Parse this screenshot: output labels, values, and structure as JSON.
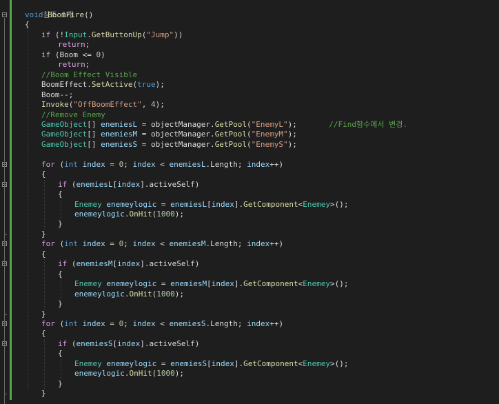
{
  "editor": {
    "reference_hint": "참조 1개",
    "lines": [
      {
        "indent": 0,
        "tokens": [
          {
            "c": "kw",
            "t": "void"
          },
          {
            "c": "plain",
            "t": " "
          },
          {
            "c": "fn",
            "t": "BoomFire"
          },
          {
            "c": "plain",
            "t": "()"
          }
        ]
      },
      {
        "indent": 0,
        "tokens": [
          {
            "c": "plain",
            "t": "{"
          }
        ]
      },
      {
        "indent": 1,
        "tokens": [
          {
            "c": "ctrl",
            "t": "if"
          },
          {
            "c": "plain",
            "t": " (!"
          },
          {
            "c": "ty",
            "t": "Input"
          },
          {
            "c": "plain",
            "t": "."
          },
          {
            "c": "fn",
            "t": "GetButtonUp"
          },
          {
            "c": "plain",
            "t": "("
          },
          {
            "c": "str",
            "t": "\"Jump\""
          },
          {
            "c": "plain",
            "t": "))"
          }
        ]
      },
      {
        "indent": 2,
        "tokens": [
          {
            "c": "ctrl",
            "t": "return"
          },
          {
            "c": "plain",
            "t": ";"
          }
        ]
      },
      {
        "indent": 1,
        "tokens": [
          {
            "c": "ctrl",
            "t": "if"
          },
          {
            "c": "plain",
            "t": " (Boom <= "
          },
          {
            "c": "num",
            "t": "0"
          },
          {
            "c": "plain",
            "t": ")"
          }
        ]
      },
      {
        "indent": 2,
        "tokens": [
          {
            "c": "ctrl",
            "t": "return"
          },
          {
            "c": "plain",
            "t": ";"
          }
        ]
      },
      {
        "indent": 1,
        "tokens": [
          {
            "c": "cm",
            "t": "//Boom Effect Visible"
          }
        ]
      },
      {
        "indent": 1,
        "tokens": [
          {
            "c": "plain",
            "t": "BoomEffect."
          },
          {
            "c": "fn",
            "t": "SetActive"
          },
          {
            "c": "plain",
            "t": "("
          },
          {
            "c": "kw",
            "t": "true"
          },
          {
            "c": "plain",
            "t": ");"
          }
        ]
      },
      {
        "indent": 1,
        "tokens": [
          {
            "c": "plain",
            "t": "Boom--;"
          }
        ]
      },
      {
        "indent": 1,
        "tokens": [
          {
            "c": "fn",
            "t": "Invoke"
          },
          {
            "c": "plain",
            "t": "("
          },
          {
            "c": "str",
            "t": "\"OffBoomEffect\""
          },
          {
            "c": "plain",
            "t": ", "
          },
          {
            "c": "num",
            "t": "4"
          },
          {
            "c": "plain",
            "t": ");"
          }
        ]
      },
      {
        "indent": 1,
        "tokens": [
          {
            "c": "cm",
            "t": "//Remove Enemy"
          }
        ]
      },
      {
        "indent": 1,
        "tokens": [
          {
            "c": "ty",
            "t": "GameObject"
          },
          {
            "c": "plain",
            "t": "[] "
          },
          {
            "c": "var",
            "t": "enemiesL"
          },
          {
            "c": "plain",
            "t": " = objectManager."
          },
          {
            "c": "fn",
            "t": "GetPool"
          },
          {
            "c": "plain",
            "t": "("
          },
          {
            "c": "str",
            "t": "\"EnemyL\""
          },
          {
            "c": "plain",
            "t": ");       "
          },
          {
            "c": "cm",
            "t": "//Find함수에서 변경."
          }
        ]
      },
      {
        "indent": 1,
        "tokens": [
          {
            "c": "ty",
            "t": "GameObject"
          },
          {
            "c": "plain",
            "t": "[] "
          },
          {
            "c": "var",
            "t": "enemiesM"
          },
          {
            "c": "plain",
            "t": " = objectManager."
          },
          {
            "c": "fn",
            "t": "GetPool"
          },
          {
            "c": "plain",
            "t": "("
          },
          {
            "c": "str",
            "t": "\"EnemyM\""
          },
          {
            "c": "plain",
            "t": ");"
          }
        ]
      },
      {
        "indent": 1,
        "tokens": [
          {
            "c": "ty",
            "t": "GameObject"
          },
          {
            "c": "plain",
            "t": "[] "
          },
          {
            "c": "var",
            "t": "enemiesS"
          },
          {
            "c": "plain",
            "t": " = objectManager."
          },
          {
            "c": "fn",
            "t": "GetPool"
          },
          {
            "c": "plain",
            "t": "("
          },
          {
            "c": "str",
            "t": "\"EnemyS\""
          },
          {
            "c": "plain",
            "t": ");"
          }
        ]
      },
      {
        "indent": 0,
        "tokens": []
      },
      {
        "indent": 1,
        "tokens": [
          {
            "c": "ctrl",
            "t": "for"
          },
          {
            "c": "plain",
            "t": " ("
          },
          {
            "c": "kw",
            "t": "int"
          },
          {
            "c": "plain",
            "t": " "
          },
          {
            "c": "var",
            "t": "index"
          },
          {
            "c": "plain",
            "t": " = "
          },
          {
            "c": "num",
            "t": "0"
          },
          {
            "c": "plain",
            "t": "; "
          },
          {
            "c": "var",
            "t": "index"
          },
          {
            "c": "plain",
            "t": " < "
          },
          {
            "c": "var",
            "t": "enemiesL"
          },
          {
            "c": "plain",
            "t": ".Length; "
          },
          {
            "c": "var",
            "t": "index"
          },
          {
            "c": "plain",
            "t": "++)"
          }
        ]
      },
      {
        "indent": 1,
        "tokens": [
          {
            "c": "plain",
            "t": "{"
          }
        ]
      },
      {
        "indent": 2,
        "tokens": [
          {
            "c": "ctrl",
            "t": "if"
          },
          {
            "c": "plain",
            "t": " ("
          },
          {
            "c": "var",
            "t": "enemiesL"
          },
          {
            "c": "plain",
            "t": "["
          },
          {
            "c": "var",
            "t": "index"
          },
          {
            "c": "plain",
            "t": "].activeSelf)"
          }
        ]
      },
      {
        "indent": 2,
        "tokens": [
          {
            "c": "plain",
            "t": "{"
          }
        ]
      },
      {
        "indent": 3,
        "tokens": [
          {
            "c": "ty",
            "t": "Enemey"
          },
          {
            "c": "plain",
            "t": " "
          },
          {
            "c": "var",
            "t": "enemeylogic"
          },
          {
            "c": "plain",
            "t": " = "
          },
          {
            "c": "var",
            "t": "enemiesL"
          },
          {
            "c": "plain",
            "t": "["
          },
          {
            "c": "var",
            "t": "index"
          },
          {
            "c": "plain",
            "t": "]."
          },
          {
            "c": "fn",
            "t": "GetComponent"
          },
          {
            "c": "plain",
            "t": "<"
          },
          {
            "c": "ty",
            "t": "Enemey"
          },
          {
            "c": "plain",
            "t": ">();"
          }
        ]
      },
      {
        "indent": 3,
        "tokens": [
          {
            "c": "var",
            "t": "enemeylogic"
          },
          {
            "c": "plain",
            "t": "."
          },
          {
            "c": "fn",
            "t": "OnHit"
          },
          {
            "c": "plain",
            "t": "("
          },
          {
            "c": "num",
            "t": "1000"
          },
          {
            "c": "plain",
            "t": ");"
          }
        ]
      },
      {
        "indent": 2,
        "tokens": [
          {
            "c": "plain",
            "t": "}"
          }
        ]
      },
      {
        "indent": 1,
        "tokens": [
          {
            "c": "plain",
            "t": "}"
          }
        ]
      },
      {
        "indent": 1,
        "tokens": [
          {
            "c": "ctrl",
            "t": "for"
          },
          {
            "c": "plain",
            "t": " ("
          },
          {
            "c": "kw",
            "t": "int"
          },
          {
            "c": "plain",
            "t": " "
          },
          {
            "c": "var",
            "t": "index"
          },
          {
            "c": "plain",
            "t": " = "
          },
          {
            "c": "num",
            "t": "0"
          },
          {
            "c": "plain",
            "t": "; "
          },
          {
            "c": "var",
            "t": "index"
          },
          {
            "c": "plain",
            "t": " < "
          },
          {
            "c": "var",
            "t": "enemiesM"
          },
          {
            "c": "plain",
            "t": ".Length; "
          },
          {
            "c": "var",
            "t": "index"
          },
          {
            "c": "plain",
            "t": "++)"
          }
        ]
      },
      {
        "indent": 1,
        "tokens": [
          {
            "c": "plain",
            "t": "{"
          }
        ]
      },
      {
        "indent": 2,
        "tokens": [
          {
            "c": "ctrl",
            "t": "if"
          },
          {
            "c": "plain",
            "t": " ("
          },
          {
            "c": "var",
            "t": "enemiesM"
          },
          {
            "c": "plain",
            "t": "["
          },
          {
            "c": "var",
            "t": "index"
          },
          {
            "c": "plain",
            "t": "].activeSelf)"
          }
        ]
      },
      {
        "indent": 2,
        "tokens": [
          {
            "c": "plain",
            "t": "{"
          }
        ]
      },
      {
        "indent": 3,
        "tokens": [
          {
            "c": "ty",
            "t": "Enemey"
          },
          {
            "c": "plain",
            "t": " "
          },
          {
            "c": "var",
            "t": "enemeylogic"
          },
          {
            "c": "plain",
            "t": " = "
          },
          {
            "c": "var",
            "t": "enemiesM"
          },
          {
            "c": "plain",
            "t": "["
          },
          {
            "c": "var",
            "t": "index"
          },
          {
            "c": "plain",
            "t": "]."
          },
          {
            "c": "fn",
            "t": "GetComponent"
          },
          {
            "c": "plain",
            "t": "<"
          },
          {
            "c": "ty",
            "t": "Enemey"
          },
          {
            "c": "plain",
            "t": ">();"
          }
        ]
      },
      {
        "indent": 3,
        "tokens": [
          {
            "c": "var",
            "t": "enemeylogic"
          },
          {
            "c": "plain",
            "t": "."
          },
          {
            "c": "fn",
            "t": "OnHit"
          },
          {
            "c": "plain",
            "t": "("
          },
          {
            "c": "num",
            "t": "1000"
          },
          {
            "c": "plain",
            "t": ");"
          }
        ]
      },
      {
        "indent": 2,
        "tokens": [
          {
            "c": "plain",
            "t": "}"
          }
        ]
      },
      {
        "indent": 1,
        "tokens": [
          {
            "c": "plain",
            "t": "}"
          }
        ]
      },
      {
        "indent": 1,
        "tokens": [
          {
            "c": "ctrl",
            "t": "for"
          },
          {
            "c": "plain",
            "t": " ("
          },
          {
            "c": "kw",
            "t": "int"
          },
          {
            "c": "plain",
            "t": " "
          },
          {
            "c": "var",
            "t": "index"
          },
          {
            "c": "plain",
            "t": " = "
          },
          {
            "c": "num",
            "t": "0"
          },
          {
            "c": "plain",
            "t": "; "
          },
          {
            "c": "var",
            "t": "index"
          },
          {
            "c": "plain",
            "t": " < "
          },
          {
            "c": "var",
            "t": "enemiesS"
          },
          {
            "c": "plain",
            "t": ".Length; "
          },
          {
            "c": "var",
            "t": "index"
          },
          {
            "c": "plain",
            "t": "++)"
          }
        ]
      },
      {
        "indent": 1,
        "tokens": [
          {
            "c": "plain",
            "t": "{"
          }
        ]
      },
      {
        "indent": 2,
        "tokens": [
          {
            "c": "ctrl",
            "t": "if"
          },
          {
            "c": "plain",
            "t": " ("
          },
          {
            "c": "var",
            "t": "enemiesS"
          },
          {
            "c": "plain",
            "t": "["
          },
          {
            "c": "var",
            "t": "index"
          },
          {
            "c": "plain",
            "t": "].activeSelf)"
          }
        ]
      },
      {
        "indent": 2,
        "tokens": [
          {
            "c": "plain",
            "t": "{"
          }
        ]
      },
      {
        "indent": 3,
        "tokens": [
          {
            "c": "ty",
            "t": "Enemey"
          },
          {
            "c": "plain",
            "t": " "
          },
          {
            "c": "var",
            "t": "enemeylogic"
          },
          {
            "c": "plain",
            "t": " = "
          },
          {
            "c": "var",
            "t": "enemiesS"
          },
          {
            "c": "plain",
            "t": "["
          },
          {
            "c": "var",
            "t": "index"
          },
          {
            "c": "plain",
            "t": "]."
          },
          {
            "c": "fn",
            "t": "GetComponent"
          },
          {
            "c": "plain",
            "t": "<"
          },
          {
            "c": "ty",
            "t": "Enemey"
          },
          {
            "c": "plain",
            "t": ">();"
          }
        ]
      },
      {
        "indent": 3,
        "tokens": [
          {
            "c": "var",
            "t": "enemeylogic"
          },
          {
            "c": "plain",
            "t": "."
          },
          {
            "c": "fn",
            "t": "OnHit"
          },
          {
            "c": "plain",
            "t": "("
          },
          {
            "c": "num",
            "t": "1000"
          },
          {
            "c": "plain",
            "t": ");"
          }
        ]
      },
      {
        "indent": 2,
        "tokens": [
          {
            "c": "plain",
            "t": "}"
          }
        ]
      },
      {
        "indent": 1,
        "tokens": [
          {
            "c": "plain",
            "t": "}"
          }
        ]
      }
    ]
  }
}
